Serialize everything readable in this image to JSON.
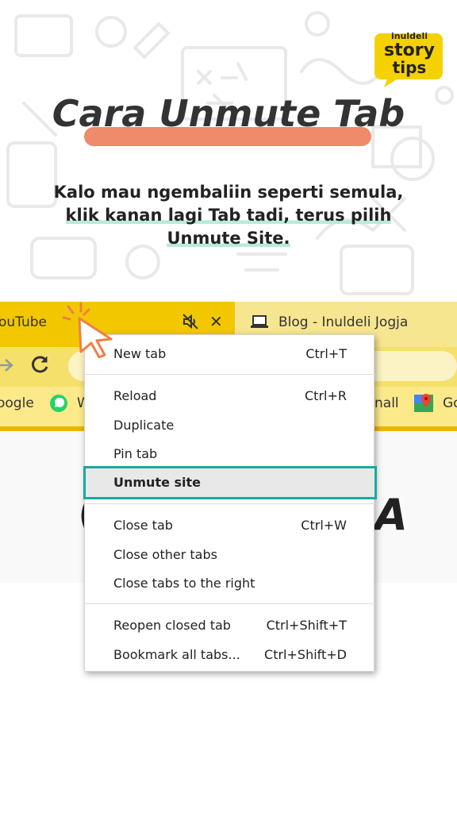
{
  "brand": {
    "line1": "inuldeli",
    "line2": "story",
    "line3": "tips",
    "accent": "#f5d100"
  },
  "title": "Cara Unmute Tab",
  "subtitle": {
    "line1": "Kalo mau ngembaliin seperti semula,",
    "line2": "klik kanan lagi Tab tadi, terus pilih",
    "line3": "Unmute Site."
  },
  "browser": {
    "tabs": [
      {
        "title": "ouTube",
        "active": true,
        "muted": true,
        "icon": "mute-icon"
      },
      {
        "title": "Blog - Inuldeli Jogja",
        "active": false,
        "icon": "laptop-icon"
      }
    ],
    "close_glyph": "✕",
    "bookmarks": [
      {
        "label": "oogle"
      },
      {
        "label": "W",
        "icon": "whatsapp-icon"
      },
      {
        "label": "nall"
      },
      {
        "label": "Go",
        "icon": "maps-icon"
      }
    ],
    "content_text_left": "(",
    "content_text_right": "A"
  },
  "context_menu": {
    "groups": [
      [
        {
          "label": "New tab",
          "shortcut": "Ctrl+T"
        }
      ],
      [
        {
          "label": "Reload",
          "shortcut": "Ctrl+R"
        },
        {
          "label": "Duplicate",
          "shortcut": ""
        },
        {
          "label": "Pin tab",
          "shortcut": ""
        },
        {
          "label": "Unmute site",
          "shortcut": "",
          "highlighted": true
        }
      ],
      [
        {
          "label": "Close tab",
          "shortcut": "Ctrl+W"
        },
        {
          "label": "Close other tabs",
          "shortcut": ""
        },
        {
          "label": "Close tabs to the right",
          "shortcut": ""
        }
      ],
      [
        {
          "label": "Reopen closed tab",
          "shortcut": "Ctrl+Shift+T"
        },
        {
          "label": "Bookmark all tabs...",
          "shortcut": "Ctrl+Shift+D"
        }
      ]
    ],
    "highlight_color": "#1aa9a0"
  },
  "colors": {
    "title_highlight": "#ef8a6a",
    "text_highlight": "#b8ead9",
    "tab_active": "#f2c700",
    "tab_inactive": "#f7e690"
  }
}
